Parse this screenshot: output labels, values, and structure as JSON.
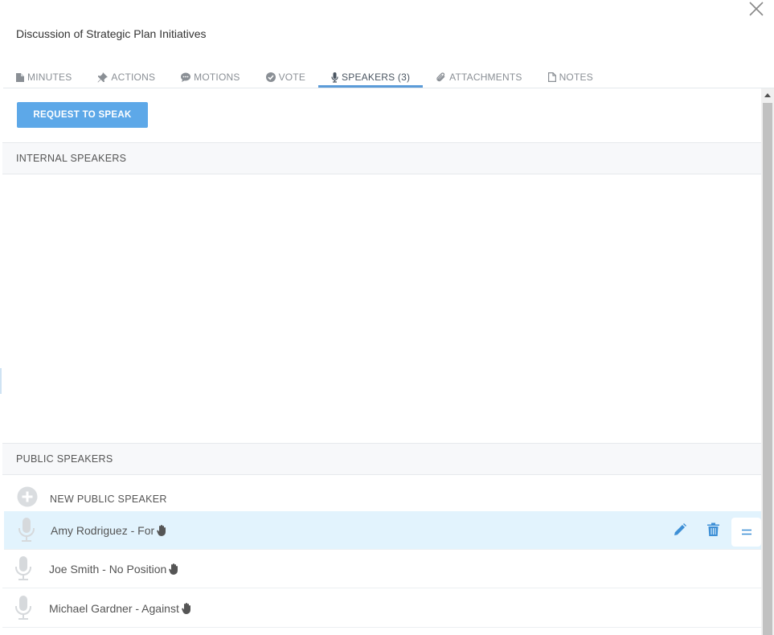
{
  "dialog": {
    "title": "Discussion of Strategic Plan Initiatives"
  },
  "tabs": [
    {
      "label": "MINUTES",
      "icon": "document-icon"
    },
    {
      "label": "ACTIONS",
      "icon": "pin-icon"
    },
    {
      "label": "MOTIONS",
      "icon": "chat-icon"
    },
    {
      "label": "VOTE",
      "icon": "check-circle-icon"
    },
    {
      "label": "SPEAKERS (3)",
      "icon": "microphone-icon",
      "active": true
    },
    {
      "label": "ATTACHMENTS",
      "icon": "paperclip-icon"
    },
    {
      "label": "NOTES",
      "icon": "file-icon"
    }
  ],
  "request_button": {
    "label": "REQUEST TO SPEAK"
  },
  "internal_speakers": {
    "header": "INTERNAL SPEAKERS"
  },
  "public_speakers": {
    "header": "PUBLIC SPEAKERS",
    "new_label": "NEW PUBLIC SPEAKER",
    "speakers": [
      {
        "name": "Amy Rodriguez - For",
        "highlighted": true
      },
      {
        "name": "Joe Smith - No Position",
        "highlighted": false
      },
      {
        "name": "Michael Gardner - Against",
        "highlighted": false
      }
    ]
  },
  "colors": {
    "accent": "#5da8e8",
    "highlight_row": "#e2f3fd",
    "tab_underline": "#5a9bd8"
  }
}
